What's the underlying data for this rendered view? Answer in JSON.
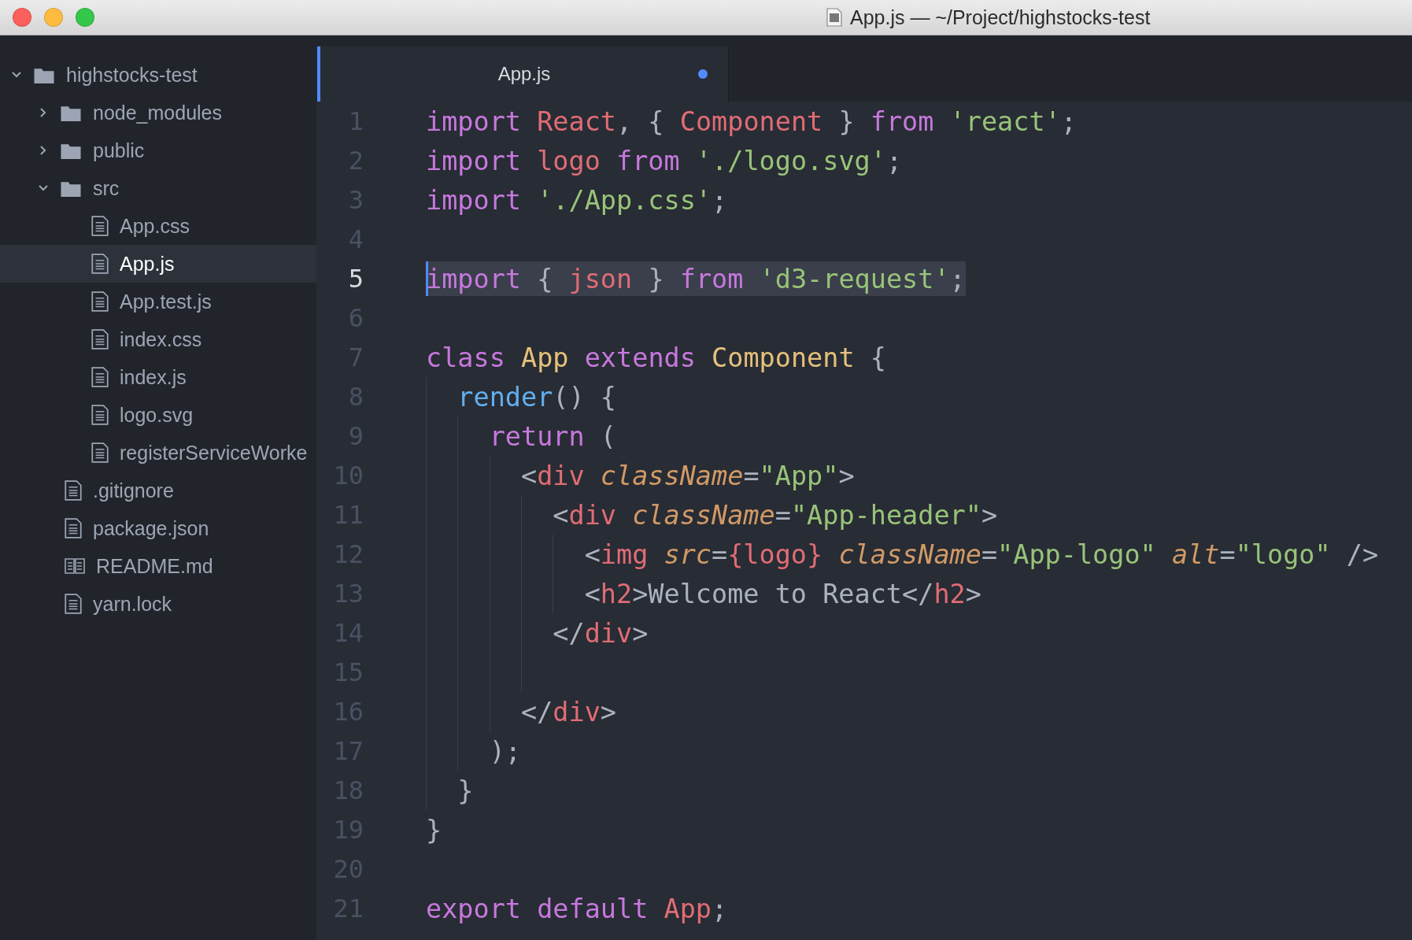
{
  "window": {
    "title": "App.js — ~/Project/highstocks-test"
  },
  "tree": [
    {
      "kind": "folder",
      "label": "highstocks-test",
      "expanded": true,
      "selected": false,
      "children": [
        {
          "kind": "folder",
          "label": "node_modules",
          "expanded": false,
          "selected": false
        },
        {
          "kind": "folder",
          "label": "public",
          "expanded": false,
          "selected": false
        },
        {
          "kind": "folder",
          "label": "src",
          "expanded": true,
          "selected": false,
          "children": [
            {
              "kind": "file",
              "label": "App.css",
              "selected": false
            },
            {
              "kind": "file",
              "label": "App.js",
              "selected": true
            },
            {
              "kind": "file",
              "label": "App.test.js",
              "selected": false
            },
            {
              "kind": "file",
              "label": "index.css",
              "selected": false
            },
            {
              "kind": "file",
              "label": "index.js",
              "selected": false
            },
            {
              "kind": "file",
              "label": "logo.svg",
              "selected": false
            },
            {
              "kind": "file",
              "label": "registerServiceWorke",
              "selected": false
            }
          ]
        },
        {
          "kind": "file",
          "label": ".gitignore",
          "selected": false
        },
        {
          "kind": "file",
          "label": "package.json",
          "selected": false
        },
        {
          "kind": "book",
          "label": "README.md",
          "selected": false
        },
        {
          "kind": "file",
          "label": "yarn.lock",
          "selected": false
        }
      ]
    }
  ],
  "tabs": [
    {
      "label": "App.js",
      "selected": true,
      "modified": true
    }
  ],
  "code": [
    {
      "number": "1",
      "current": false,
      "tokens": [
        {
          "kind": "kw",
          "text": "import "
        },
        {
          "kind": "var",
          "text": "React"
        },
        {
          "kind": "punc",
          "text": ", { "
        },
        {
          "kind": "var",
          "text": "Component"
        },
        {
          "kind": "punc",
          "text": " } "
        },
        {
          "kind": "kw",
          "text": "from "
        },
        {
          "kind": "str",
          "text": "'react'"
        },
        {
          "kind": "punc",
          "text": ";"
        }
      ]
    },
    {
      "number": "2",
      "current": false,
      "tokens": [
        {
          "kind": "kw",
          "text": "import "
        },
        {
          "kind": "var",
          "text": "logo "
        },
        {
          "kind": "kw",
          "text": "from "
        },
        {
          "kind": "str",
          "text": "'./logo.svg'"
        },
        {
          "kind": "punc",
          "text": ";"
        }
      ]
    },
    {
      "number": "3",
      "current": false,
      "tokens": [
        {
          "kind": "kw",
          "text": "import "
        },
        {
          "kind": "str",
          "text": "'./App.css'"
        },
        {
          "kind": "punc",
          "text": ";"
        }
      ]
    },
    {
      "number": "4",
      "current": false
    },
    {
      "number": "5",
      "current": true,
      "tokens": [
        {
          "kind": "kw",
          "text": "import "
        },
        {
          "kind": "punc",
          "text": "{ "
        },
        {
          "kind": "var",
          "text": "json"
        },
        {
          "kind": "punc",
          "text": " } "
        },
        {
          "kind": "kw",
          "text": "from "
        },
        {
          "kind": "str",
          "text": "'d3-request'"
        },
        {
          "kind": "punc",
          "text": ";"
        }
      ]
    },
    {
      "number": "6",
      "current": false
    },
    {
      "number": "7",
      "current": false,
      "tokens": [
        {
          "kind": "kw",
          "text": "class "
        },
        {
          "kind": "cls",
          "text": "App "
        },
        {
          "kind": "kw",
          "text": "extends "
        },
        {
          "kind": "cls",
          "text": "Component "
        },
        {
          "kind": "punc",
          "text": "{"
        }
      ]
    },
    {
      "number": "8",
      "current": false,
      "tokens": [
        {
          "kind": "fn",
          "text": "  render"
        },
        {
          "kind": "punc",
          "text": "() {"
        }
      ]
    },
    {
      "number": "9",
      "current": false,
      "tokens": [
        {
          "kind": "kw",
          "text": "    return "
        },
        {
          "kind": "punc",
          "text": "("
        }
      ]
    },
    {
      "number": "10",
      "current": false,
      "tokens": [
        {
          "kind": "punc",
          "text": "      <"
        },
        {
          "kind": "var",
          "text": "div "
        },
        {
          "kind": "attr",
          "text": "className"
        },
        {
          "kind": "punc",
          "text": "="
        },
        {
          "kind": "str",
          "text": "\"App\""
        },
        {
          "kind": "punc",
          "text": ">"
        }
      ]
    },
    {
      "number": "11",
      "current": false,
      "tokens": [
        {
          "kind": "punc",
          "text": "        <"
        },
        {
          "kind": "var",
          "text": "div "
        },
        {
          "kind": "attr",
          "text": "className"
        },
        {
          "kind": "punc",
          "text": "="
        },
        {
          "kind": "str",
          "text": "\"App-header\""
        },
        {
          "kind": "punc",
          "text": ">"
        }
      ]
    },
    {
      "number": "12",
      "current": false,
      "tokens": [
        {
          "kind": "punc",
          "text": "          <"
        },
        {
          "kind": "var",
          "text": "img "
        },
        {
          "kind": "attr",
          "text": "src"
        },
        {
          "kind": "punc",
          "text": "="
        },
        {
          "kind": "var",
          "text": "{logo} "
        },
        {
          "kind": "attr",
          "text": "className"
        },
        {
          "kind": "punc",
          "text": "="
        },
        {
          "kind": "str",
          "text": "\"App-logo\" "
        },
        {
          "kind": "attr",
          "text": "alt"
        },
        {
          "kind": "punc",
          "text": "="
        },
        {
          "kind": "str",
          "text": "\"logo\""
        },
        {
          "kind": "punc",
          "text": " />"
        }
      ]
    },
    {
      "number": "13",
      "current": false,
      "tokens": [
        {
          "kind": "punc",
          "text": "          <"
        },
        {
          "kind": "var",
          "text": "h2"
        },
        {
          "kind": "punc",
          "text": ">Welcome to React</"
        },
        {
          "kind": "var",
          "text": "h2"
        },
        {
          "kind": "punc",
          "text": ">"
        }
      ]
    },
    {
      "number": "14",
      "current": false,
      "tokens": [
        {
          "kind": "punc",
          "text": "        </"
        },
        {
          "kind": "var",
          "text": "div"
        },
        {
          "kind": "punc",
          "text": ">"
        }
      ]
    },
    {
      "number": "15",
      "current": false
    },
    {
      "number": "16",
      "current": false,
      "tokens": [
        {
          "kind": "punc",
          "text": "      </"
        },
        {
          "kind": "var",
          "text": "div"
        },
        {
          "kind": "punc",
          "text": ">"
        }
      ]
    },
    {
      "number": "17",
      "current": false,
      "tokens": [
        {
          "kind": "punc",
          "text": "    );"
        }
      ]
    },
    {
      "number": "18",
      "current": false,
      "tokens": [
        {
          "kind": "punc",
          "text": "  }"
        }
      ]
    },
    {
      "number": "19",
      "current": false,
      "tokens": [
        {
          "kind": "punc",
          "text": "}"
        }
      ]
    },
    {
      "number": "20",
      "current": false
    },
    {
      "number": "21",
      "current": false,
      "tokens": [
        {
          "kind": "kw",
          "text": "export default "
        },
        {
          "kind": "var",
          "text": "App"
        },
        {
          "kind": "punc",
          "text": ";"
        }
      ]
    }
  ]
}
